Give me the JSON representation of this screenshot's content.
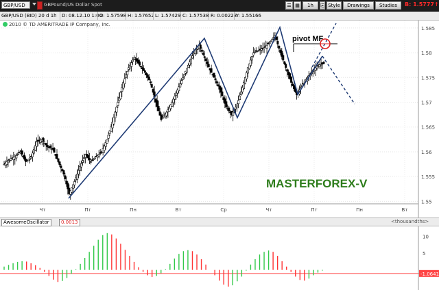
{
  "toolbar": {
    "symbol": "GBP/USD",
    "symbol_description": "GBPound/US Dollar Spot",
    "timeframe": "1h",
    "style_label": "Style",
    "drawings_label": "Drawings",
    "studies_label": "Studies",
    "live_price": "B: 1.5777↑"
  },
  "info_bar": {
    "title": "GBP/USD (BID) 20 d 1h",
    "date": "D: 08.12.10 1:00",
    "open": "O: 1.57598",
    "high": "H: 1.57652",
    "low": "L: 1.57429",
    "close": "C: 1.57538",
    "change": "R: 0.00223",
    "y_value": "Y: 1.55166"
  },
  "copyright": "2010 © TD AMERITRADE IP Company, Inc.",
  "annotations": {
    "pivot": "pivot MF",
    "watermark": "MASTERFOREX-V"
  },
  "colors": {
    "accent_blue": "#1f3b74",
    "watermark_green": "#2e7d1c",
    "osc_up": "#33c94a",
    "osc_down": "#ff3333",
    "marker_red": "#dd2222"
  },
  "chart_data": {
    "type": "candlestick",
    "price_axis": {
      "labels": [
        "1.585",
        "1.58",
        "1.575",
        "1.57",
        "1.565",
        "1.56",
        "1.555",
        "1.55"
      ],
      "ylim": [
        1.5495,
        1.5865
      ]
    },
    "time_axis": {
      "labels": [
        "Чт",
        "Пт",
        "Пн",
        "Вт",
        "Ср",
        "Чт",
        "Пт",
        "Пн",
        "Вт"
      ]
    },
    "price_path": [
      [
        0,
        1.5575
      ],
      [
        2,
        1.5585
      ],
      [
        4,
        1.559
      ],
      [
        6,
        1.56
      ],
      [
        8,
        1.558
      ],
      [
        10,
        1.559
      ],
      [
        12,
        1.562
      ],
      [
        14,
        1.5625
      ],
      [
        16,
        1.561
      ],
      [
        18,
        1.5605
      ],
      [
        20,
        1.558
      ],
      [
        22,
        1.5555
      ],
      [
        24,
        1.5515
      ],
      [
        26,
        1.554
      ],
      [
        28,
        1.557
      ],
      [
        30,
        1.5595
      ],
      [
        32,
        1.558
      ],
      [
        34,
        1.559
      ],
      [
        36,
        1.56
      ],
      [
        38,
        1.5625
      ],
      [
        40,
        1.566
      ],
      [
        42,
        1.57
      ],
      [
        44,
        1.574
      ],
      [
        46,
        1.577
      ],
      [
        48,
        1.579
      ],
      [
        50,
        1.5775
      ],
      [
        52,
        1.576
      ],
      [
        54,
        1.574
      ],
      [
        56,
        1.57
      ],
      [
        58,
        1.5665
      ],
      [
        60,
        1.568
      ],
      [
        62,
        1.57
      ],
      [
        64,
        1.5725
      ],
      [
        66,
        1.575
      ],
      [
        68,
        1.5775
      ],
      [
        70,
        1.58
      ],
      [
        72,
        1.5815
      ],
      [
        74,
        1.579
      ],
      [
        76,
        1.5765
      ],
      [
        78,
        1.5745
      ],
      [
        80,
        1.572
      ],
      [
        82,
        1.569
      ],
      [
        84,
        1.5675
      ],
      [
        86,
        1.5695
      ],
      [
        88,
        1.573
      ],
      [
        90,
        1.577
      ],
      [
        92,
        1.58
      ],
      [
        94,
        1.5805
      ],
      [
        96,
        1.581
      ],
      [
        98,
        1.582
      ],
      [
        100,
        1.5835
      ],
      [
        102,
        1.58
      ],
      [
        104,
        1.577
      ],
      [
        106,
        1.574
      ],
      [
        108,
        1.5715
      ],
      [
        110,
        1.5735
      ],
      [
        112,
        1.575
      ],
      [
        114,
        1.5765
      ],
      [
        116,
        1.5775
      ],
      [
        118,
        1.5778
      ]
    ],
    "osc_axis": {
      "labels": [
        "10",
        "5",
        "-1.0641"
      ],
      "ylim": [
        -6,
        13
      ]
    },
    "oscillator": [
      1.0,
      1.5,
      2.0,
      2.4,
      2.6,
      2.5,
      2.0,
      1.4,
      0.6,
      -0.6,
      -1.8,
      -2.9,
      -3.6,
      -3.3,
      -2.4,
      -1.2,
      0.2,
      1.8,
      3.6,
      5.4,
      7.2,
      9.0,
      10.4,
      11.0,
      10.6,
      9.4,
      7.8,
      6.0,
      4.2,
      2.4,
      0.8,
      -0.6,
      -1.6,
      -2.1,
      -1.8,
      -1.0,
      0.2,
      1.8,
      3.4,
      4.8,
      5.6,
      5.9,
      5.6,
      4.6,
      3.2,
      1.6,
      0.0,
      -1.6,
      -3.2,
      -4.4,
      -5.0,
      -4.6,
      -3.4,
      -2.0,
      -0.2,
      1.6,
      3.2,
      4.6,
      5.4,
      5.8,
      5.4,
      4.2,
      2.6,
      1.0,
      -0.6,
      -2.0,
      -3.0,
      -3.2,
      -2.6,
      -1.6,
      -0.8,
      -0.2
    ],
    "osc_reference": -1.0641
  }
}
